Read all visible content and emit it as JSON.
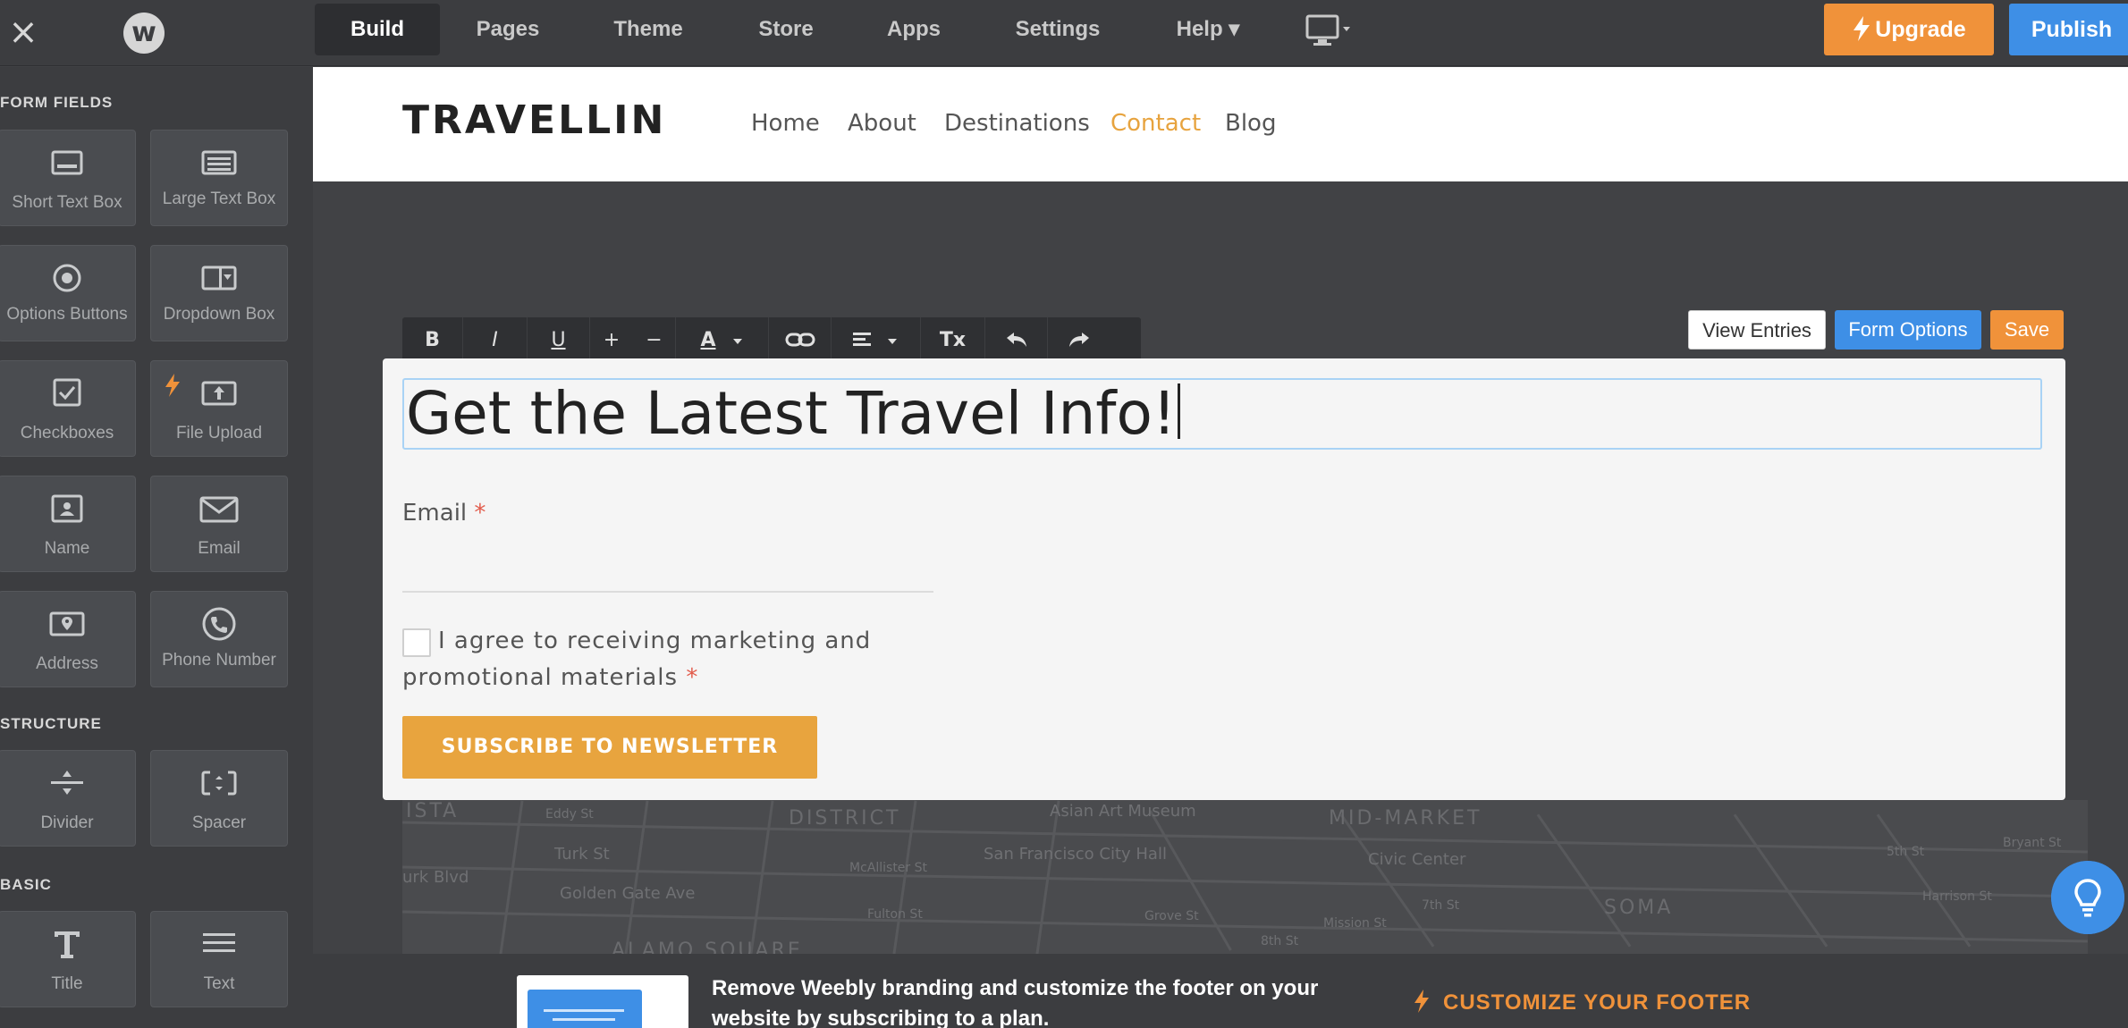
{
  "topbar": {
    "close_glyph": "×",
    "logo_glyph": "w",
    "tabs": [
      {
        "label": "Build"
      },
      {
        "label": "Pages"
      },
      {
        "label": "Theme"
      },
      {
        "label": "Store"
      },
      {
        "label": "Apps"
      },
      {
        "label": "Settings"
      },
      {
        "label": "Help ▾"
      }
    ],
    "upgrade_label": "Upgrade",
    "publish_label": "Publish"
  },
  "sidebar": {
    "form_fields_label": "FORM FIELDS",
    "structure_label": "STRUCTURE",
    "basic_label": "BASIC",
    "form_fields": [
      {
        "label": "Short Text Box",
        "icon": "short-text-box-icon"
      },
      {
        "label": "Large Text Box",
        "icon": "large-text-box-icon"
      },
      {
        "label": "Options Buttons",
        "icon": "options-buttons-icon"
      },
      {
        "label": "Dropdown Box",
        "icon": "dropdown-box-icon"
      },
      {
        "label": "Checkboxes",
        "icon": "checkboxes-icon"
      },
      {
        "label": "File Upload",
        "icon": "file-upload-icon"
      },
      {
        "label": "Name",
        "icon": "name-icon"
      },
      {
        "label": "Email",
        "icon": "email-icon"
      },
      {
        "label": "Address",
        "icon": "address-icon"
      },
      {
        "label": "Phone Number",
        "icon": "phone-number-icon"
      }
    ],
    "structure": [
      {
        "label": "Divider",
        "icon": "divider-icon"
      },
      {
        "label": "Spacer",
        "icon": "spacer-icon"
      }
    ],
    "basic": [
      {
        "label": "Title",
        "icon": "title-icon"
      },
      {
        "label": "Text",
        "icon": "text-icon"
      }
    ]
  },
  "site": {
    "brand": "TRAVELLIN",
    "nav": [
      {
        "label": "Home"
      },
      {
        "label": "About"
      },
      {
        "label": "Destinations"
      },
      {
        "label": "Contact"
      },
      {
        "label": "Blog"
      }
    ],
    "active_nav": "Contact"
  },
  "format_toolbar": {
    "bold": "B",
    "italic": "I",
    "underline": "U",
    "increase": "+",
    "decrease": "−",
    "color": "A",
    "clear_format": "Tx"
  },
  "form_actions": {
    "view_entries": "View Entries",
    "form_options": "Form Options",
    "save": "Save"
  },
  "form": {
    "title": "Get the Latest Travel Info!",
    "email_label": "Email",
    "required_mark": "*",
    "email_value": "",
    "agree_text": "I agree to receiving marketing and promotional materials",
    "subscribe_label": "SUBSCRIBE TO NEWSLETTER"
  },
  "map_labels": {
    "vista": "ISTA",
    "eddy": "Eddy St",
    "turk": "Turk St",
    "golden_gate": "Golden Gate Ave",
    "turk_blvd": "urk Blvd",
    "alamo": "ALAMO SQUARE",
    "district": "DISTRICT",
    "museum": "Asian Art Museum",
    "city_hall": "San Francisco City Hall",
    "mid_market": "MID-MARKET",
    "civic": "Civic Center",
    "soma": "SOMA",
    "mcallister": "McAllister St",
    "fulton": "Fulton St",
    "grove": "Grove St",
    "mission": "Mission St",
    "seventh": "7th St",
    "eighth": "8th St",
    "fifth": "5th St",
    "harrison": "Harrison St",
    "bryant": "Bryant St"
  },
  "footer": {
    "text": "Remove Weebly branding and customize the footer on your website by subscribing to a plan.",
    "cta": "CUSTOMIZE YOUR FOOTER"
  },
  "colors": {
    "accent_orange": "#f0923a",
    "accent_blue": "#3e8fe6",
    "contact_active": "#e7a33e",
    "subscribe": "#e8a43e"
  }
}
